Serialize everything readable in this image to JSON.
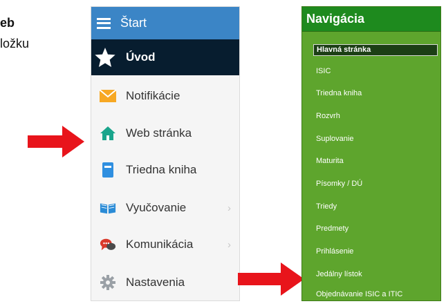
{
  "partial_text": {
    "line1": "eb",
    "line2": "ložku"
  },
  "left_menu": {
    "header": "Štart",
    "items": [
      {
        "label": "Úvod",
        "icon": "star-icon",
        "active": true
      },
      {
        "label": "Notifikácie",
        "icon": "envelope-icon"
      },
      {
        "label": "Web stránka",
        "icon": "home-icon"
      },
      {
        "label": "Triedna kniha",
        "icon": "book-icon"
      },
      {
        "label": "Vyučovanie",
        "icon": "open-book-icon",
        "chevron": "›"
      },
      {
        "label": "Komunikácia",
        "icon": "chat-icon",
        "chevron": "›"
      },
      {
        "label": "Nastavenia",
        "icon": "gear-icon"
      }
    ]
  },
  "nav_panel": {
    "title": "Navigácia",
    "items": [
      "Hlavná stránka",
      "ISIC",
      "Triedna kniha",
      "Rozvrh",
      "Suplovanie",
      "Maturita",
      "Písomky / DÚ",
      "Triedy",
      "Predmety",
      "Prihlásenie",
      "Jedálny lístok",
      "Objednávanie ISIC a ITIC"
    ]
  },
  "colors": {
    "menu_header": "#3b85c6",
    "menu_active": "#071d2f",
    "nav_bg": "#5ea52d",
    "nav_title": "#1e8a1e",
    "arrow": "#e8141b"
  }
}
